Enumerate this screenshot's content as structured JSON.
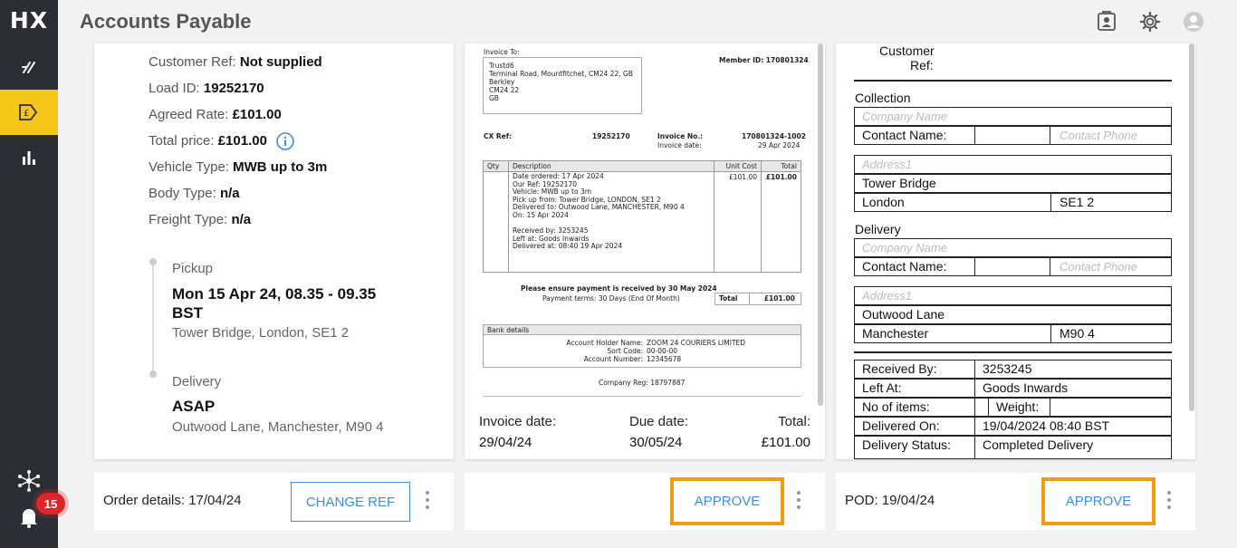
{
  "app": {
    "logo_text": "HX",
    "title": "Accounts Payable"
  },
  "sidebar": {
    "items": [
      {
        "name": "route-icon",
        "active": false
      },
      {
        "name": "invoice-icon",
        "active": true
      },
      {
        "name": "bar-chart-icon",
        "active": false
      }
    ],
    "notification_count": "15"
  },
  "order": {
    "fields": [
      {
        "label": "Customer Ref:",
        "value": "Not supplied"
      },
      {
        "label": "Load ID:",
        "value": "19252170"
      },
      {
        "label": "Agreed Rate:",
        "value": "£101.00"
      },
      {
        "label": "Total price:",
        "value": "£101.00"
      },
      {
        "label": "Vehicle Type:",
        "value": "MWB up to 3m"
      },
      {
        "label": "Body Type:",
        "value": "n/a"
      },
      {
        "label": "Freight Type:",
        "value": "n/a"
      }
    ],
    "pickup": {
      "label": "Pickup",
      "time_line1": "Mon 15 Apr 24, 08.35 - 09.35",
      "time_line2": "BST",
      "address": "Tower Bridge, London, SE1 2"
    },
    "delivery": {
      "label": "Delivery",
      "time": "ASAP",
      "address": "Outwood Lane, Manchester, M90 4"
    },
    "footer_text": "Order details: 17/04/24",
    "change_ref_label": "CHANGE REF"
  },
  "invoice": {
    "invoice_to_label": "Invoice To:",
    "address_lines": [
      "Trustd6",
      "Terminal Road, Mountfitchet, CM24 22, GB",
      "Berkley",
      "CM24 22",
      "GB"
    ],
    "member_id": "Member ID: 170801324",
    "cx_ref_label": "CX Ref:",
    "cx_ref_value": "19252170",
    "invoice_no_label": "Invoice No.:",
    "invoice_no_value": "170801324-1002",
    "invoice_date_label": "Invoice date:",
    "invoice_date_value": "29 Apr 2024",
    "table_headers": [
      "Qty",
      "Description",
      "Unit Cost",
      "Total"
    ],
    "description_lines": [
      "Date ordered: 17 Apr 2024",
      "Our Ref: 19252170",
      "Vehicle: MWB up to 3m",
      "Pick up from: Tower Bridge, LONDON, SE1 2",
      "Delivered to: Outwood Lane, MANCHESTER, M90 4",
      "On: 15 Apr 2024",
      "",
      "Received by: 3253245",
      "Left at: Goods Inwards",
      "Delivered at: 08:40 19 Apr 2024"
    ],
    "unit_cost": "£101.00",
    "line_total": "£101.00",
    "payment_notice": "Please ensure payment is received by 30 May 2024",
    "payment_terms": "Payment terms: 30 Days (End Of Month)",
    "total_label": "Total",
    "total_value": "£101.00",
    "bank_details_label": "Bank details",
    "bank": [
      {
        "label": "Account Holder Name:",
        "value": "ZOOM 24 COURIERS LIMITED"
      },
      {
        "label": "Sort Code:",
        "value": "00-00-00"
      },
      {
        "label": "Account Number:",
        "value": "12345678"
      }
    ],
    "company_reg": "Company Reg: 18797887",
    "footer": {
      "invoice_date_label": "Invoice date:",
      "invoice_date_value": "29/04/24",
      "due_date_label": "Due date:",
      "due_date_value": "30/05/24",
      "total_label": "Total:",
      "total_value": "£101.00"
    },
    "approve_label": "APPROVE"
  },
  "pod": {
    "customer_ref_label_1": "Customer",
    "customer_ref_label_2": "Ref:",
    "collection_label": "Collection",
    "collection": {
      "company_placeholder": "Company Name",
      "contact_label": "Contact Name:",
      "phone_placeholder": "Contact Phone",
      "address_placeholder": "Address1",
      "address_line": "Tower Bridge",
      "city": "London",
      "postcode": "SE1 2"
    },
    "delivery_label": "Delivery",
    "delivery": {
      "company_placeholder": "Company Name",
      "contact_label": "Contact Name:",
      "phone_placeholder": "Contact Phone",
      "address_placeholder": "Address1",
      "address_line": "Outwood Lane",
      "city": "Manchester",
      "postcode": "M90 4"
    },
    "received_by_label": "Received By:",
    "received_by_value": "3253245",
    "left_at_label": "Left At:",
    "left_at_value": "Goods Inwards",
    "items_label": "No of items:",
    "weight_label": "Weight:",
    "delivered_on_label": "Delivered On:",
    "delivered_on_value": "19/04/2024 08:40 BST",
    "status_label": "Delivery Status:",
    "status_value": "Completed Delivery",
    "footer_text": "POD: 19/04/24",
    "approve_label": "APPROVE"
  },
  "colors": {
    "sidebar": "#2b2e35",
    "accent": "#f5c518",
    "link": "#3a8fe0",
    "highlight": "#f39c12",
    "badge": "#e0242c"
  }
}
